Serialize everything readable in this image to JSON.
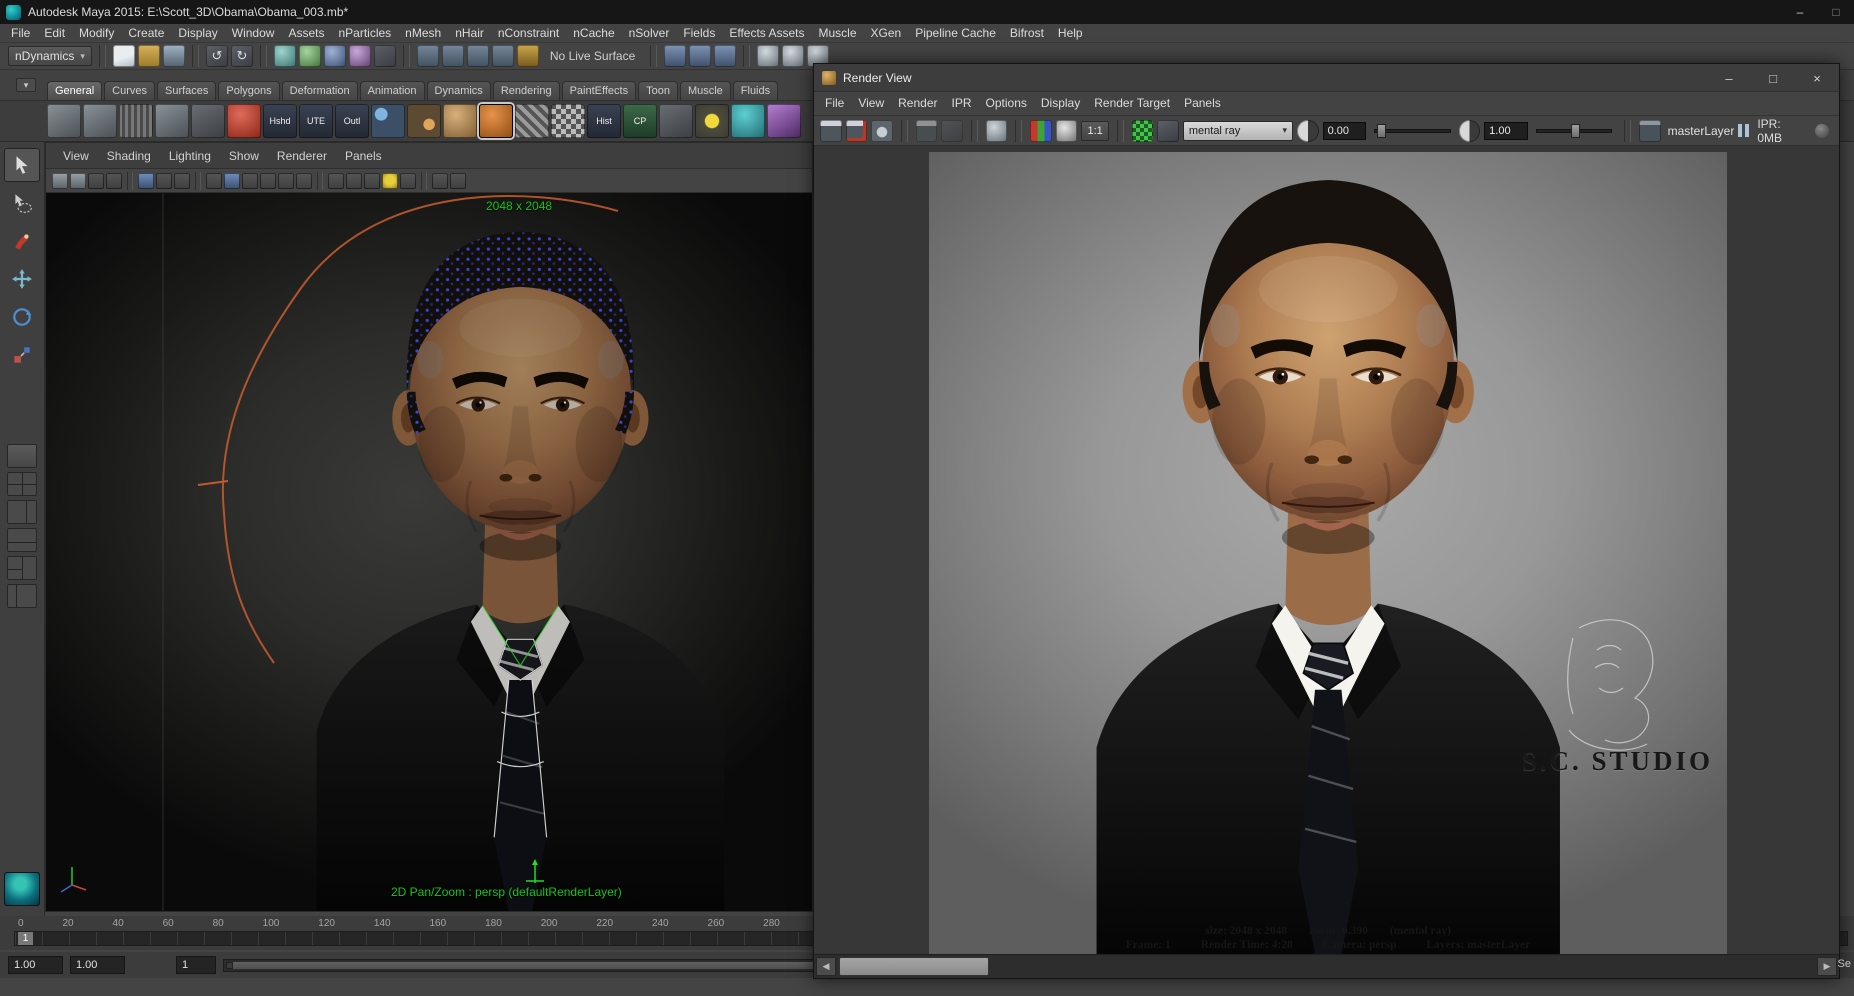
{
  "window": {
    "title": "Autodesk Maya 2015: E:\\Scott_3D\\Obama\\Obama_003.mb*",
    "controls": {
      "minimize": "–",
      "maximize": "□",
      "close": "×"
    }
  },
  "icons": {
    "caret": "▾",
    "caret_right": "▸",
    "undo": "↺",
    "redo": "↻",
    "left_arrow": "◀",
    "right_arrow": "▶"
  },
  "menubar": {
    "items": [
      "File",
      "Edit",
      "Modify",
      "Create",
      "Display",
      "Window",
      "Assets",
      "nParticles",
      "nMesh",
      "nHair",
      "nConstraint",
      "nCache",
      "nSolver",
      "Fields",
      "Effects Assets",
      "Muscle",
      "XGen",
      "Pipeline Cache",
      "Bifrost",
      "Help"
    ]
  },
  "statusline": {
    "menuset": "nDynamics",
    "live_surface": "No Live Surface"
  },
  "shelf": {
    "tabs": [
      "General",
      "Curves",
      "Surfaces",
      "Polygons",
      "Deformation",
      "Animation",
      "Dynamics",
      "Rendering",
      "PaintEffects",
      "Toon",
      "Muscle",
      "Fluids"
    ],
    "labels": [
      "Hshd",
      "UTE",
      "Outl",
      "Hist",
      "CP"
    ]
  },
  "panel": {
    "menus": [
      "View",
      "Shading",
      "Lighting",
      "Show",
      "Renderer",
      "Panels"
    ]
  },
  "viewport": {
    "resolution": "2048 x 2048",
    "pan_zoom": "2D Pan/Zoom : persp (defaultRenderLayer)"
  },
  "timeslider": {
    "ticks": [
      "0",
      "20",
      "40",
      "60",
      "80",
      "100",
      "120",
      "140",
      "160",
      "180",
      "200",
      "220",
      "240",
      "260",
      "280"
    ],
    "current": "1"
  },
  "rangeslider": {
    "anim_start": "1.00",
    "play_start": "1.00",
    "frame": "1"
  },
  "renderview": {
    "title": "Render View",
    "menus": [
      "File",
      "View",
      "Render",
      "IPR",
      "Options",
      "Display",
      "Render Target",
      "Panels"
    ],
    "controls": {
      "minimize": "–",
      "maximize": "□",
      "close": "×"
    },
    "toolbar": {
      "renderer": "mental ray",
      "ratio": "1:1",
      "exposure": "0.00",
      "gamma": "1.00",
      "layer": "masterLayer",
      "ipr": "IPR: 0MB"
    },
    "stamp": {
      "size": "size: 2048 x 2048",
      "zoom": "zoom: 0.390",
      "engine": "(mental ray)",
      "frame": "Frame: 1",
      "time": "Render Time: 4:28",
      "camera": "Camera: persp",
      "layers": "Layers: masterLayer"
    },
    "watermark": "S.C. STUDIO"
  },
  "misc": {
    "bottom_right": "Se"
  },
  "colors": {
    "hud_green": "#1cc21c",
    "arc_orange": "#c05a2e",
    "ui_bg": "#444444",
    "render_bg_gray": "#989898"
  }
}
